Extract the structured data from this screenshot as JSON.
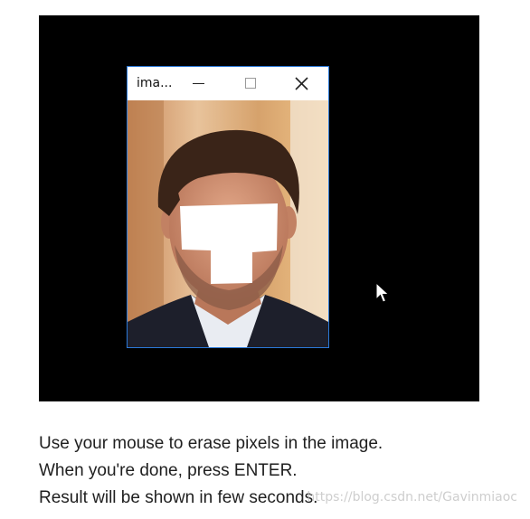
{
  "window": {
    "title": "ima...",
    "buttons": {
      "minimize": "minimize",
      "maximize": "maximize",
      "close": "close"
    }
  },
  "instructions": [
    "Use your mouse to erase pixels in the image.",
    "When you're done, press ENTER.",
    "Result will be shown in few seconds."
  ],
  "watermark": "https://blog.csdn.net/Gavinmiaoc",
  "icons": {
    "minimize": "minimize-icon",
    "maximize": "maximize-icon",
    "close": "close-icon",
    "cursor": "mouse-pointer-icon"
  },
  "colors": {
    "screen_background": "#000000",
    "window_border": "#2b79d8",
    "erased_region": "#ffffff"
  }
}
